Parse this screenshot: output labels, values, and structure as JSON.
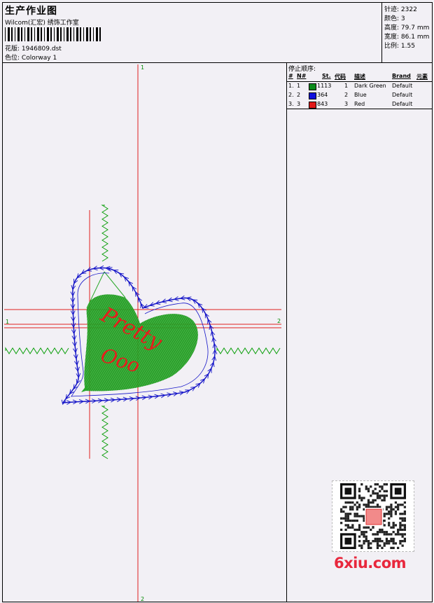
{
  "header": {
    "title": "生产作业图",
    "subtitle": "Wilcom(汇宏) 绣饰工作室",
    "design_label": "花版:",
    "design_value": "1946809.dst",
    "colorway_label": "色位:",
    "colorway_value": "Colorway 1"
  },
  "stats": {
    "stitches_label": "针迹:",
    "stitches_value": "2322",
    "colors_label": "颜色:",
    "colors_value": "3",
    "height_label": "高度:",
    "height_value": "79.7 mm",
    "width_label": "宽度:",
    "width_value": "86.1 mm",
    "scale_label": "比例:",
    "scale_value": "1.55"
  },
  "stop_sequence": {
    "title": "停止顺序:",
    "columns": [
      "#",
      "N#",
      "St.",
      "代码",
      "描述",
      "Brand",
      "元素"
    ],
    "rows": [
      {
        "index": "1.",
        "needle": "1",
        "stitches": "1113",
        "code": "1",
        "desc": "Dark Green",
        "brand": "Default",
        "color": "#0a8a1a"
      },
      {
        "index": "2.",
        "needle": "2",
        "stitches": "364",
        "code": "2",
        "desc": "Blue",
        "brand": "Default",
        "color": "#1010dd"
      },
      {
        "index": "3.",
        "needle": "3",
        "stitches": "843",
        "code": "3",
        "desc": "Red",
        "brand": "Default",
        "color": "#e01818"
      }
    ]
  },
  "design": {
    "text_line1": "Pretty",
    "text_line2": "Ooo",
    "fill_color": "#2aa82a",
    "outline_color": "#1414c8",
    "text_color": "#e81c1c",
    "guide_color": "#e02020",
    "marker_color": "#10a010",
    "axis_top": "1",
    "axis_bottom": "2",
    "axis_left": "1",
    "axis_right": "2"
  },
  "watermark": {
    "text": "6xiu.com"
  }
}
